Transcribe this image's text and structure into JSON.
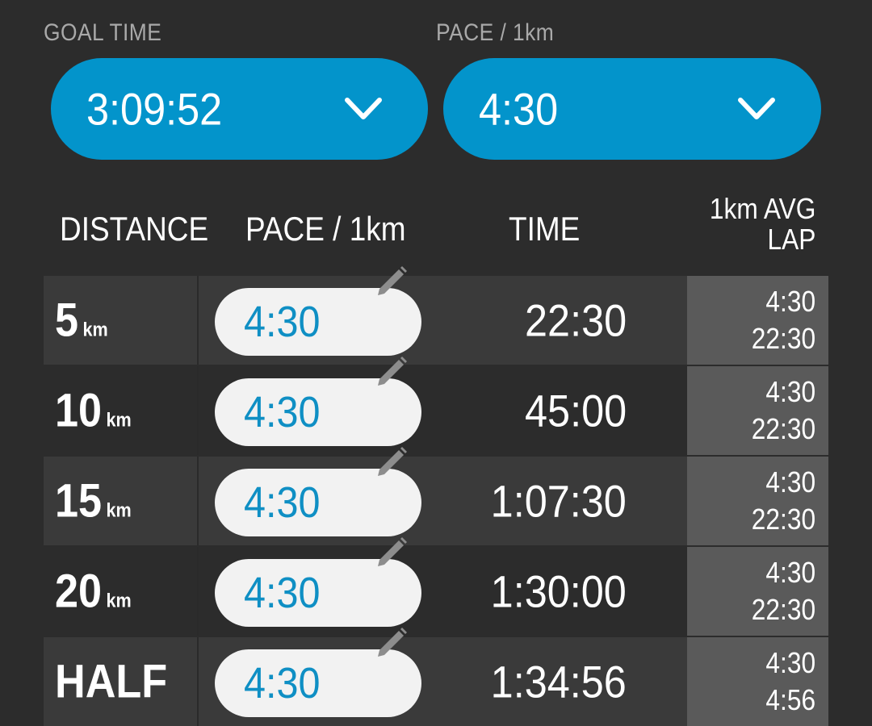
{
  "goal": {
    "label": "GOAL TIME",
    "value": "3:09:52"
  },
  "pace": {
    "label": "PACE / 1km",
    "value": "4:30"
  },
  "columns": {
    "distance": "DISTANCE",
    "pace": "PACE / 1km",
    "time": "TIME",
    "lap_line1": "1km AVG",
    "lap_line2": "LAP"
  },
  "rows": [
    {
      "distance": "5",
      "unit": "km",
      "pace": "4:30",
      "time": "22:30",
      "avg": "4:30",
      "lap": "22:30"
    },
    {
      "distance": "10",
      "unit": "km",
      "pace": "4:30",
      "time": "45:00",
      "avg": "4:30",
      "lap": "22:30"
    },
    {
      "distance": "15",
      "unit": "km",
      "pace": "4:30",
      "time": "1:07:30",
      "avg": "4:30",
      "lap": "22:30"
    },
    {
      "distance": "20",
      "unit": "km",
      "pace": "4:30",
      "time": "1:30:00",
      "avg": "4:30",
      "lap": "22:30"
    },
    {
      "distance": "HALF",
      "unit": "",
      "pace": "4:30",
      "time": "1:34:56",
      "avg": "4:30",
      "lap": "4:56"
    }
  ],
  "icons": {
    "dropdown": "chevron-down-icon",
    "edit": "pencil-icon"
  },
  "colors": {
    "accent": "#0394cb",
    "background": "#2c2c2c",
    "row_alt": "#3a3a3a",
    "lap_column": "#5a5a5a",
    "pace_text": "#0f8fc4",
    "muted_label": "#a9a9a9"
  }
}
